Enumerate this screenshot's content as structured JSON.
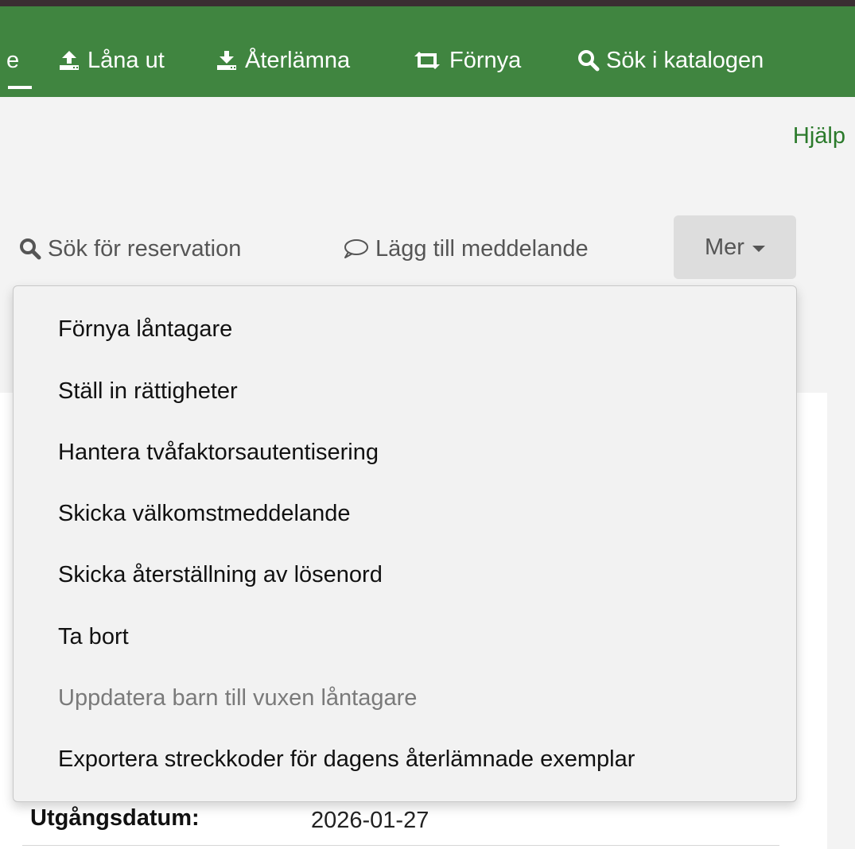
{
  "nav": {
    "partial_label": "e",
    "items": [
      {
        "label": "Låna ut",
        "icon": "upload-icon"
      },
      {
        "label": "Återlämna",
        "icon": "download-icon"
      },
      {
        "label": "Förnya",
        "icon": "retweet-icon"
      },
      {
        "label": "Sök i katalogen",
        "icon": "search-icon"
      }
    ]
  },
  "help_label": "Hjälp",
  "toolbar": {
    "search_hold_label": "Sök för reservation",
    "add_message_label": "Lägg till meddelande",
    "more_label": "Mer"
  },
  "menu": {
    "items": [
      {
        "label": "Förnya låntagare",
        "disabled": false
      },
      {
        "label": "Ställ in rättigheter",
        "disabled": false
      },
      {
        "label": "Hantera tvåfaktorsautentisering",
        "disabled": false
      },
      {
        "label": "Skicka välkomstmeddelande",
        "disabled": false
      },
      {
        "label": "Skicka återställning av lösenord",
        "disabled": false
      },
      {
        "label": "Ta bort",
        "disabled": false
      },
      {
        "label": "Uppdatera barn till vuxen låntagare",
        "disabled": true
      },
      {
        "label": "Exportera streckkoder för dagens återlämnade exemplar",
        "disabled": false
      }
    ]
  },
  "patron": {
    "expiry_label": "Utgångsdatum:",
    "expiry_value": "2026-01-27"
  },
  "colors": {
    "navbar": "#408540",
    "help_link": "#2b7a2b",
    "topbar": "#3a2e32"
  }
}
